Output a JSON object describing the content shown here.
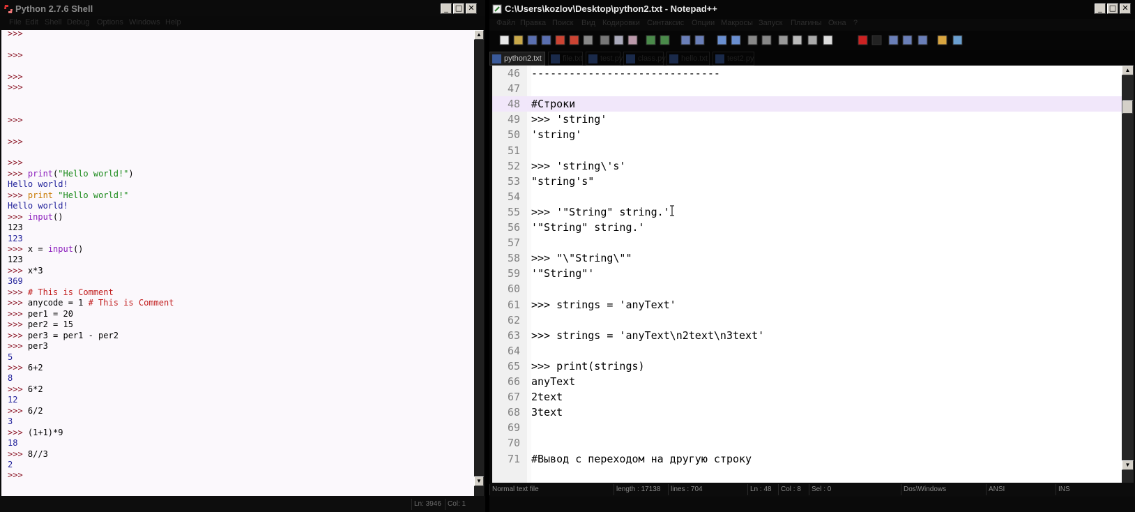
{
  "idle": {
    "title": "Python 2.7.6 Shell",
    "menu": [
      "File",
      "Edit",
      "Shell",
      "Debug",
      "Options",
      "Windows",
      "Help"
    ],
    "status": {
      "ln": "Ln: 3946",
      "col": "Col: 1"
    },
    "lines": [
      {
        "row": 0,
        "parts": [
          {
            "c": "prompt",
            "t": ">>>"
          }
        ]
      },
      {
        "row": 2,
        "parts": [
          {
            "c": "prompt",
            "t": ">>>"
          }
        ]
      },
      {
        "row": 4,
        "parts": [
          {
            "c": "prompt",
            "t": ">>>"
          }
        ]
      },
      {
        "row": 5,
        "parts": [
          {
            "c": "prompt",
            "t": ">>>"
          }
        ]
      },
      {
        "row": 8,
        "parts": [
          {
            "c": "prompt",
            "t": ">>>"
          }
        ]
      },
      {
        "row": 10,
        "parts": [
          {
            "c": "prompt",
            "t": ">>>"
          }
        ]
      },
      {
        "row": 12,
        "parts": [
          {
            "c": "prompt",
            "t": ">>>"
          }
        ]
      },
      {
        "row": 13,
        "parts": [
          {
            "c": "prompt",
            "t": ">>> "
          },
          {
            "c": "fn",
            "t": "print"
          },
          {
            "c": "code",
            "t": "("
          },
          {
            "c": "str",
            "t": "\"Hello world!\""
          },
          {
            "c": "code",
            "t": ")"
          }
        ]
      },
      {
        "row": 14,
        "parts": [
          {
            "c": "out",
            "t": "Hello world!"
          }
        ]
      },
      {
        "row": 15,
        "parts": [
          {
            "c": "prompt",
            "t": ">>> "
          },
          {
            "c": "kw",
            "t": "print"
          },
          {
            "c": "code",
            "t": " "
          },
          {
            "c": "str",
            "t": "\"Hello world!\""
          }
        ]
      },
      {
        "row": 16,
        "parts": [
          {
            "c": "out",
            "t": "Hello world!"
          }
        ]
      },
      {
        "row": 17,
        "parts": [
          {
            "c": "prompt",
            "t": ">>> "
          },
          {
            "c": "fn",
            "t": "input"
          },
          {
            "c": "code",
            "t": "()"
          }
        ]
      },
      {
        "row": 18,
        "parts": [
          {
            "c": "code",
            "t": "123"
          }
        ]
      },
      {
        "row": 19,
        "parts": [
          {
            "c": "out",
            "t": "123"
          }
        ]
      },
      {
        "row": 20,
        "parts": [
          {
            "c": "prompt",
            "t": ">>> "
          },
          {
            "c": "code",
            "t": "x = "
          },
          {
            "c": "fn",
            "t": "input"
          },
          {
            "c": "code",
            "t": "()"
          }
        ]
      },
      {
        "row": 21,
        "parts": [
          {
            "c": "code",
            "t": "123"
          }
        ]
      },
      {
        "row": 22,
        "parts": [
          {
            "c": "prompt",
            "t": ">>> "
          },
          {
            "c": "code",
            "t": "x*3"
          }
        ]
      },
      {
        "row": 23,
        "parts": [
          {
            "c": "out",
            "t": "369"
          }
        ]
      },
      {
        "row": 24,
        "parts": [
          {
            "c": "prompt",
            "t": ">>> "
          },
          {
            "c": "cmt",
            "t": "# This is Comment"
          }
        ]
      },
      {
        "row": 25,
        "parts": [
          {
            "c": "prompt",
            "t": ">>> "
          },
          {
            "c": "code",
            "t": "anycode = 1 "
          },
          {
            "c": "cmt",
            "t": "# This is Comment"
          }
        ]
      },
      {
        "row": 26,
        "parts": [
          {
            "c": "prompt",
            "t": ">>> "
          },
          {
            "c": "code",
            "t": "per1 = 20"
          }
        ]
      },
      {
        "row": 27,
        "parts": [
          {
            "c": "prompt",
            "t": ">>> "
          },
          {
            "c": "code",
            "t": "per2 = 15"
          }
        ]
      },
      {
        "row": 28,
        "parts": [
          {
            "c": "prompt",
            "t": ">>> "
          },
          {
            "c": "code",
            "t": "per3 = per1 - per2"
          }
        ]
      },
      {
        "row": 29,
        "parts": [
          {
            "c": "prompt",
            "t": ">>> "
          },
          {
            "c": "code",
            "t": "per3"
          }
        ]
      },
      {
        "row": 30,
        "parts": [
          {
            "c": "out",
            "t": "5"
          }
        ]
      },
      {
        "row": 31,
        "parts": [
          {
            "c": "prompt",
            "t": ">>> "
          },
          {
            "c": "code",
            "t": "6+2"
          }
        ]
      },
      {
        "row": 32,
        "parts": [
          {
            "c": "out",
            "t": "8"
          }
        ]
      },
      {
        "row": 33,
        "parts": [
          {
            "c": "prompt",
            "t": ">>> "
          },
          {
            "c": "code",
            "t": "6*2"
          }
        ]
      },
      {
        "row": 34,
        "parts": [
          {
            "c": "out",
            "t": "12"
          }
        ]
      },
      {
        "row": 35,
        "parts": [
          {
            "c": "prompt",
            "t": ">>> "
          },
          {
            "c": "code",
            "t": "6/2"
          }
        ]
      },
      {
        "row": 36,
        "parts": [
          {
            "c": "out",
            "t": "3"
          }
        ]
      },
      {
        "row": 37,
        "parts": [
          {
            "c": "prompt",
            "t": ">>> "
          },
          {
            "c": "code",
            "t": "(1+1)*9"
          }
        ]
      },
      {
        "row": 38,
        "parts": [
          {
            "c": "out",
            "t": "18"
          }
        ]
      },
      {
        "row": 39,
        "parts": [
          {
            "c": "prompt",
            "t": ">>> "
          },
          {
            "c": "code",
            "t": "8//3"
          }
        ]
      },
      {
        "row": 40,
        "parts": [
          {
            "c": "out",
            "t": "2"
          }
        ]
      },
      {
        "row": 41,
        "parts": [
          {
            "c": "prompt",
            "t": ">>>"
          }
        ]
      }
    ]
  },
  "npp": {
    "title": "C:\\Users\\kozlov\\Desktop\\python2.txt - Notepad++",
    "menu": [
      "Файл",
      "Правка",
      "Поиск",
      "Вид",
      "Кодировки",
      "Синтаксис",
      "Опции",
      "Макросы",
      "Запуск",
      "Плагины",
      "Окна",
      "?"
    ],
    "tabs": [
      {
        "label": "python2.txt",
        "active": true
      },
      {
        "label": "file.txt",
        "active": false
      },
      {
        "label": "test.py",
        "active": false
      },
      {
        "label": "class.py",
        "active": false
      },
      {
        "label": "hello.txt",
        "active": false
      },
      {
        "label": "test2.py",
        "active": false
      }
    ],
    "lines": [
      {
        "n": "46",
        "t": "------------------------------",
        "hl": false
      },
      {
        "n": "47",
        "t": "",
        "hl": false
      },
      {
        "n": "48",
        "t": "#Строки",
        "hl": true
      },
      {
        "n": "49",
        "t": ">>> 'string'",
        "hl": false
      },
      {
        "n": "50",
        "t": "'string'",
        "hl": false
      },
      {
        "n": "51",
        "t": "",
        "hl": false
      },
      {
        "n": "52",
        "t": ">>> 'string\\'s'",
        "hl": false
      },
      {
        "n": "53",
        "t": "\"string's\"",
        "hl": false
      },
      {
        "n": "54",
        "t": "",
        "hl": false
      },
      {
        "n": "55",
        "t": ">>> '\"String\" string.'",
        "hl": false
      },
      {
        "n": "56",
        "t": "'\"String\" string.'",
        "hl": false
      },
      {
        "n": "57",
        "t": "",
        "hl": false
      },
      {
        "n": "58",
        "t": ">>> \"\\\"String\\\"\"",
        "hl": false
      },
      {
        "n": "59",
        "t": "'\"String\"'",
        "hl": false
      },
      {
        "n": "60",
        "t": "",
        "hl": false
      },
      {
        "n": "61",
        "t": ">>> strings = 'anyText'",
        "hl": false
      },
      {
        "n": "62",
        "t": "",
        "hl": false
      },
      {
        "n": "63",
        "t": ">>> strings = 'anyText\\n2text\\n3text'",
        "hl": false
      },
      {
        "n": "64",
        "t": "",
        "hl": false
      },
      {
        "n": "65",
        "t": ">>> print(strings)",
        "hl": false
      },
      {
        "n": "66",
        "t": "anyText",
        "hl": false
      },
      {
        "n": "67",
        "t": "2text",
        "hl": false
      },
      {
        "n": "68",
        "t": "3text",
        "hl": false
      },
      {
        "n": "69",
        "t": "",
        "hl": false
      },
      {
        "n": "70",
        "t": "",
        "hl": false
      },
      {
        "n": "71",
        "t": "#Вывод с переходом на другую строку",
        "hl": false
      }
    ],
    "status": {
      "filetype": "Normal text file",
      "length": "length : 17138",
      "lines": "lines : 704",
      "ln": "Ln : 48",
      "col": "Col : 8",
      "sel": "Sel : 0",
      "eol": "Dos\\Windows",
      "encoding": "ANSI",
      "mode": "INS"
    }
  }
}
